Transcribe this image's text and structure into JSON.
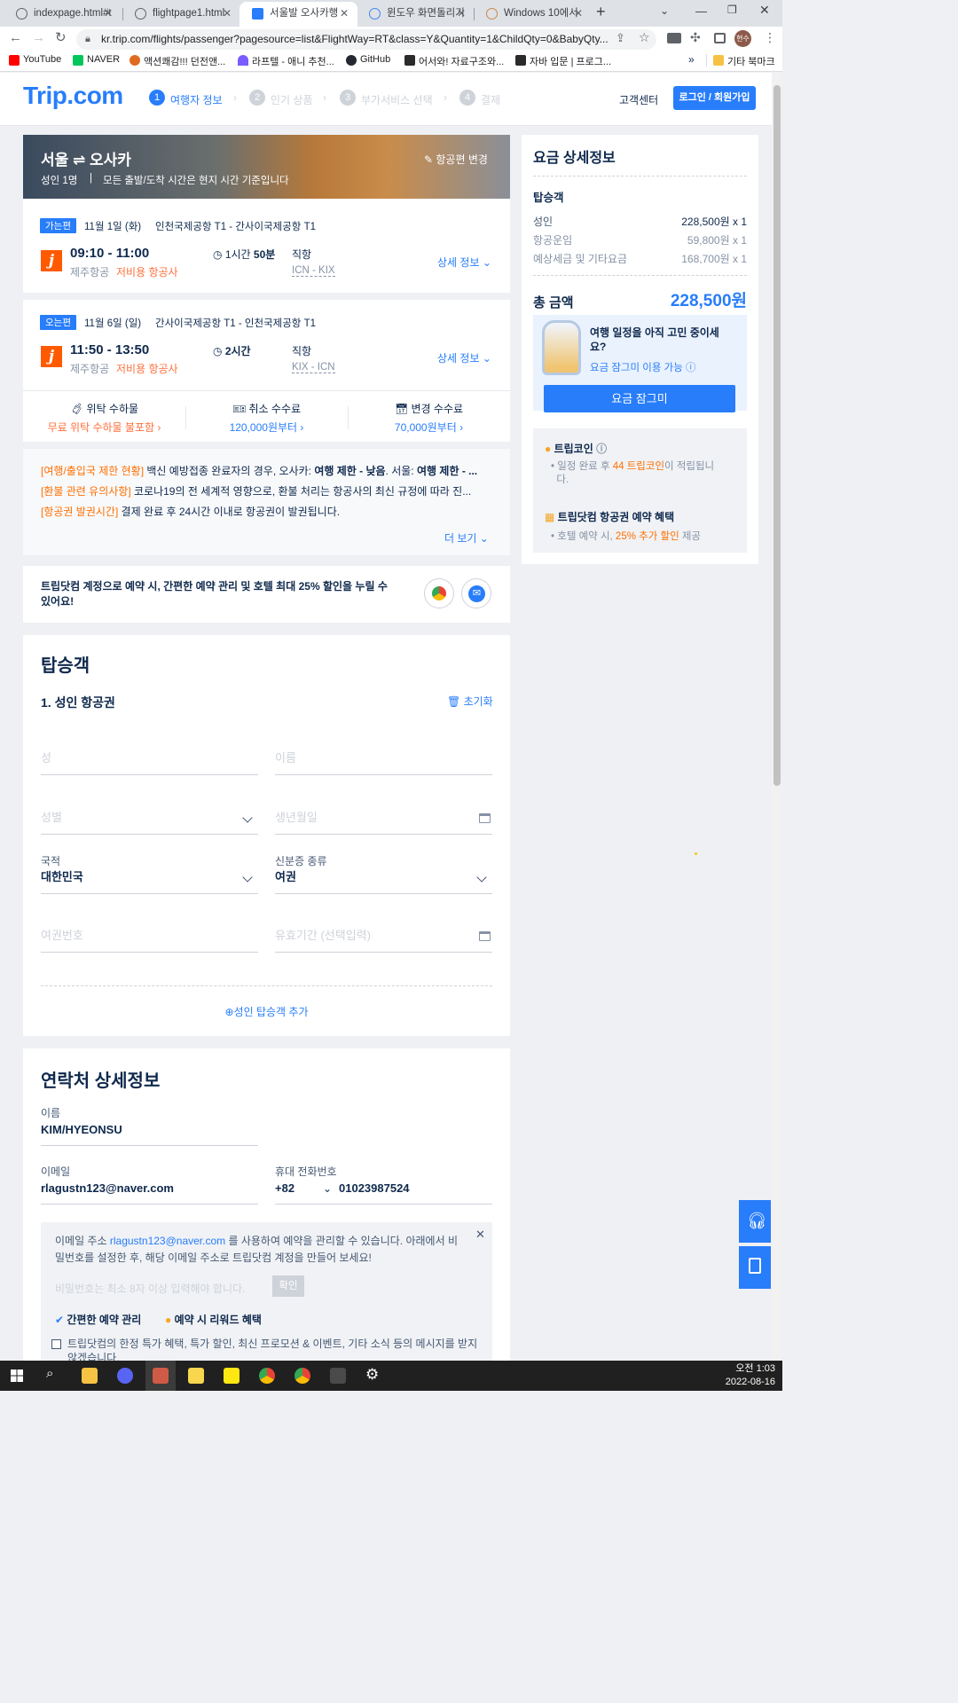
{
  "browser": {
    "tabs": [
      "indexpage.html#t",
      "flightpage1.html",
      "서울발 오사카행",
      "윈도우 화면돌리기",
      "Windows 10에서"
    ],
    "url": "kr.trip.com/flights/passenger?pagesource=list&FlightWay=RT&class=Y&Quantity=1&ChildQty=0&BabyQty...",
    "profile": "현수",
    "bookmarks": [
      "YouTube",
      "NAVER",
      "액션쾌감!!! 던전앤...",
      "라프텔 - 애니 추천...",
      "GitHub",
      "어서와! 자료구조와...",
      "자바 입문 | 프로그...",
      "기타 북마크"
    ],
    "bm_more": "»",
    "colors": {
      "youtube": "#ff0000",
      "naver": "#03c75a",
      "d1": "#e06b1f",
      "laftel": "#7b5cff",
      "github": "#24292f",
      "tag": "#2b2b2b",
      "folder": "#f6c244"
    }
  },
  "header": {
    "logo_a": "Trip",
    "logo_b": ".com",
    "steps": [
      {
        "n": "1",
        "label": "여행자 정보"
      },
      {
        "n": "2",
        "label": "인기 상품"
      },
      {
        "n": "3",
        "label": "부가서비스 선택"
      },
      {
        "n": "4",
        "label": "결제"
      }
    ],
    "support": "고객센터",
    "login": "로그인 / 회원가입"
  },
  "trip": {
    "route": "서울 ⇌ 오사카",
    "pax": "성인 1명",
    "note": "모든 출발/도착 시간은 현지 시간 기준입니다",
    "change": "항공편 변경",
    "legs": [
      {
        "badge": "가는편",
        "date": "11월 1일 (화)",
        "airports": "인천국제공항 T1 - 간사이국제공항 T1",
        "time": "09:10 - 11:00",
        "airline": "제주항공",
        "lcc": "저비용 항공사",
        "duration_a": "1시간",
        "duration_b": " 50분",
        "type": "직항",
        "codes": "ICN - KIX",
        "detail": "상세 정보"
      },
      {
        "badge": "오는편",
        "date": "11월 6일 (일)",
        "airports": "간사이국제공항 T1 - 인천국제공항 T1",
        "time": "11:50 - 13:50",
        "airline": "제주항공",
        "lcc": "저비용 항공사",
        "duration_a": "2시간",
        "duration_b": "",
        "type": "직항",
        "codes": "KIX - ICN",
        "detail": "상세 정보"
      }
    ],
    "fees": [
      {
        "title": "위탁 수하물",
        "value": "무료 위탁 수하물 불포함"
      },
      {
        "title": "취소 수수료",
        "value": "120,000원부터"
      },
      {
        "title": "변경 수수료",
        "value": "70,000원부터"
      }
    ],
    "notices": [
      {
        "tag": "[여행/출입국 제한 현황]",
        "text": " 백신 예방접종 완료자의 경우, 오사카: ",
        "b1": "여행 제한 - 낮음",
        "t2": ". 서울: ",
        "b2": "여행 제한 - ..."
      },
      {
        "tag": "[환불 관련 유의사항]",
        "text": " 코로나19의 전 세계적 영향으로, 환불 처리는 항공사의 최신 규정에 따라 진..."
      },
      {
        "tag": "[항공권 발권시간]",
        "text": " 결제 완료 후 24시간 이내로 항공권이 발권됩니다."
      }
    ],
    "more": "더 보기"
  },
  "promo": {
    "text1": "트립닷컴 계정으로 예약 시, 간편한 예약 관리 및 호텔 최대 ",
    "b": "25%",
    "text2": " 할인을 누릴 수",
    "text3": "있어요!"
  },
  "passenger": {
    "title": "탑승객",
    "subtitle": "1. 성인 항공권",
    "reset": "초기화",
    "last": "성",
    "first": "이름",
    "gender": "성별",
    "dob": "생년월일",
    "nat_label": "국적",
    "nat": "대한민국",
    "id_label": "신분증 종류",
    "id": "여권",
    "passport": "여권번호",
    "expiry": "유효기간 (선택입력)",
    "add": "성인 탑승객 추가"
  },
  "contact": {
    "title": "연락처 상세정보",
    "name_label": "이름",
    "name": "KIM/HYEONSU",
    "email_label": "이메일",
    "email": "rlagustn123@naver.com",
    "phone_label": "휴대 전화번호",
    "cc": "+82",
    "phone": "01023987524",
    "box_a": "이메일 주소 ",
    "box_email": "rlagustn123@naver.com",
    "box_b": " 를 사용하여 예약을 관리할 수 있습니다. 아래에서 비",
    "box_c": "밀번호를 설정한 후, 해당 이메일 주소로 트립닷컴 계정을 만들어 보세요!",
    "pw_placeholder": "비밀번호는 최소 8자 이상 입력해야 합니다.",
    "confirm": "확인",
    "perk1": "간편한 예약 관리",
    "perk2": "예약 시 리워드 혜택",
    "consent": "트립닷컴의 한정 특가 혜택, 특가 할인, 최신 프로모션 & 이벤트, 기타 소식 등의 메시지를 받지",
    "consent2": "않겠습니다."
  },
  "price": {
    "title": "요금 상세정보",
    "section": "탑승객",
    "rows": [
      {
        "label": "성인",
        "value": "228,500원 x 1"
      },
      {
        "label": "항공운임",
        "value": "59,800원 x 1"
      },
      {
        "label": "예상세금 및 기타요금",
        "value": "168,700원 x 1"
      }
    ],
    "total_label": "총 금액",
    "total": "228,500원",
    "hold_text1": "여행 일정을 아직 고민 중이세",
    "hold_text2": "요?",
    "hold_link": "요금 잠그미 이용 가능",
    "hold_btn": "요금 잠그미",
    "coin_title": "트립코인",
    "coin_a": "일정 완료 후 ",
    "coin_n": "44 트립코인",
    "coin_b": "이 적립됩니",
    "coin_c": "다.",
    "benefit_title": "트립닷컴 항공권 예약 혜택",
    "benefit_a": "호텔 예약 시, ",
    "benefit_b": "25% 추가 할인",
    "benefit_c": " 제공"
  },
  "taskbar": {
    "time": "오전 1:03",
    "date": "2022-08-16"
  }
}
